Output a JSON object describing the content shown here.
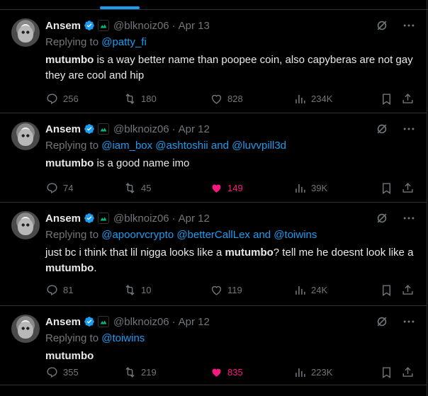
{
  "tweets": [
    {
      "name": "Ansem",
      "handle": "@blknoiz06",
      "sep": "·",
      "date": "Apr 13",
      "reply_prefix": "Replying to",
      "reply_to": "@patty_fi",
      "text_bold": "mutumbo",
      "text_rest": " is a way better name than poopee coin, also capyberas are not gay they are cool and hip",
      "replies": "256",
      "retweets": "180",
      "likes": "828",
      "views": "234K",
      "liked": false
    },
    {
      "name": "Ansem",
      "handle": "@blknoiz06",
      "sep": "·",
      "date": "Apr 12",
      "reply_prefix": "Replying to",
      "reply_to": "@iam_box @ashtoshii and @luvvpill3d",
      "text_bold": "mutumbo",
      "text_rest": " is a good name imo",
      "replies": "74",
      "retweets": "45",
      "likes": "149",
      "views": "39K",
      "liked": true
    },
    {
      "name": "Ansem",
      "handle": "@blknoiz06",
      "sep": "·",
      "date": "Apr 12",
      "reply_prefix": "Replying to",
      "reply_to": "@apoorvcrypto @betterCallLex and @toiwins",
      "text_pre": "just bc i think that lil nigga looks like a ",
      "text_bold": "mutumbo",
      "text_mid": "? tell me he doesnt look like a ",
      "text_bold2": "mutumbo",
      "text_end": ".",
      "replies": "81",
      "retweets": "10",
      "likes": "119",
      "views": "24K",
      "liked": false
    },
    {
      "name": "Ansem",
      "handle": "@blknoiz06",
      "sep": "·",
      "date": "Apr 12",
      "reply_prefix": "Replying to",
      "reply_to": "@toiwins",
      "text_bold": "mutumbo",
      "replies": "355",
      "retweets": "219",
      "likes": "835",
      "views": "223K",
      "liked": true
    }
  ],
  "colors": {
    "accent": "#1d9bf0",
    "like": "#f91880",
    "muted": "#71767b",
    "verified": "#1d9bf0",
    "affiliate": "#00ba7c"
  },
  "icons": [
    "verified-badge-icon",
    "affiliate-badge-icon",
    "grok-icon",
    "more-icon",
    "reply-icon",
    "retweet-icon",
    "like-icon",
    "views-icon",
    "bookmark-icon",
    "share-icon"
  ]
}
